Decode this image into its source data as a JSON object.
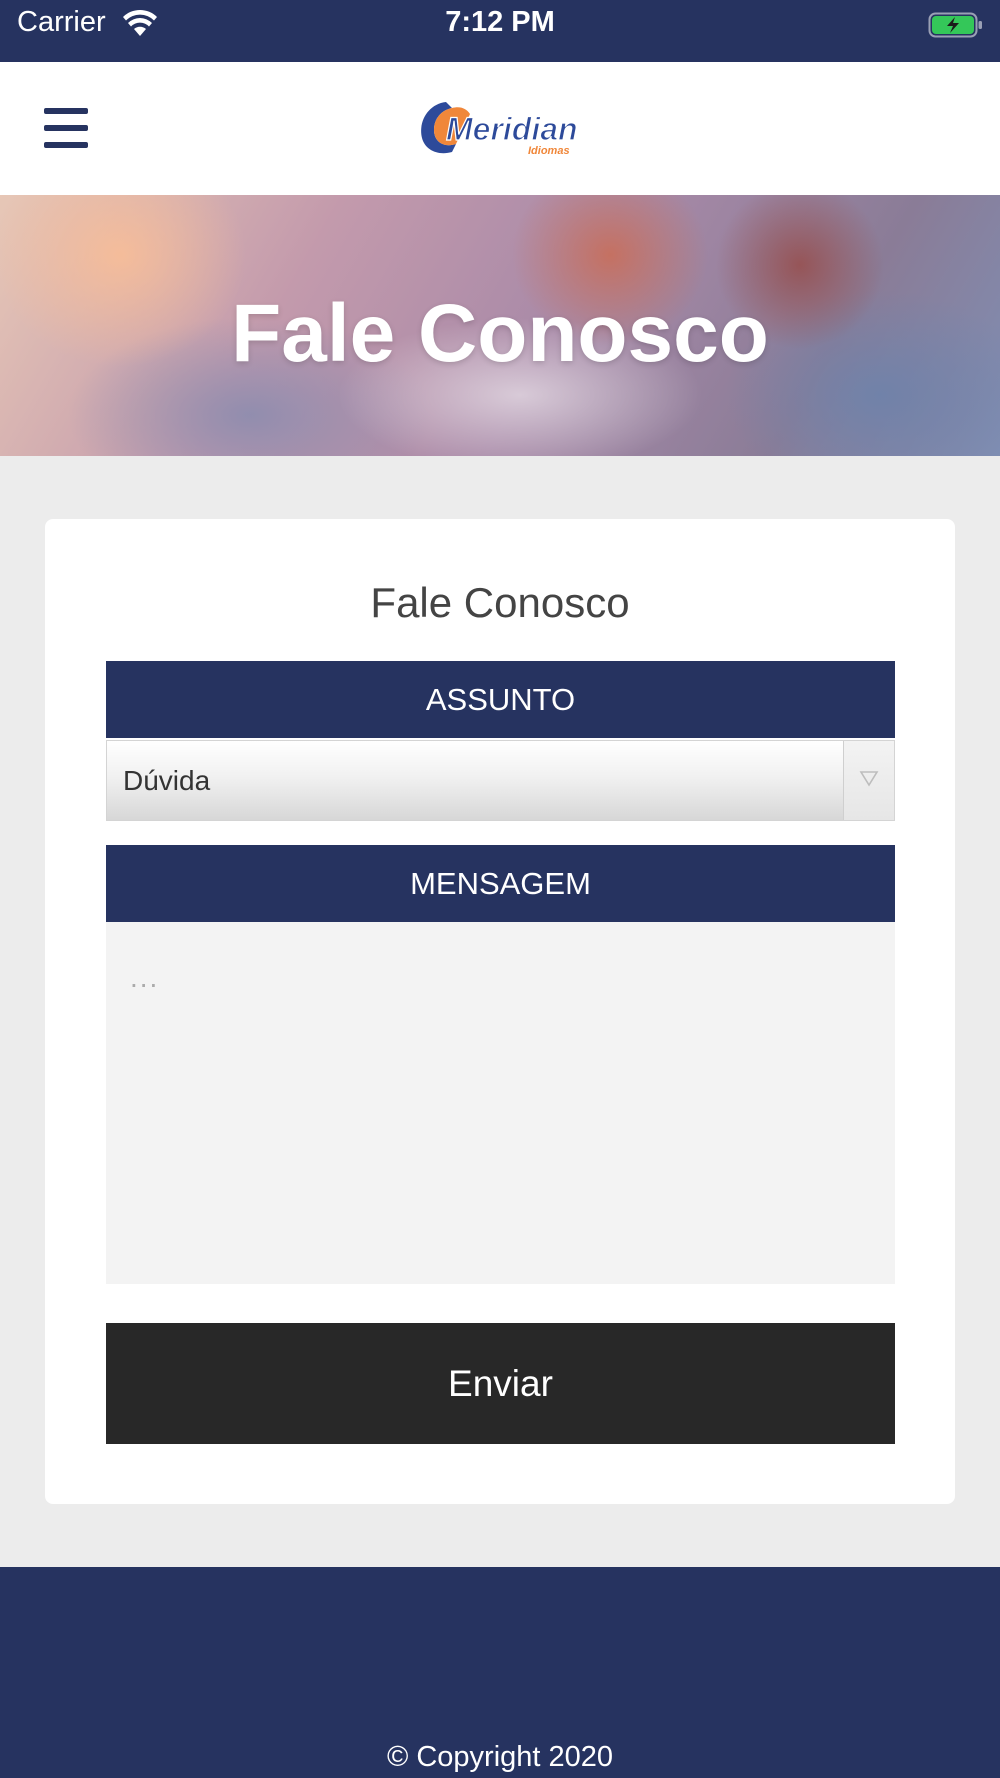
{
  "status_bar": {
    "carrier": "Carrier",
    "time": "7:12 PM",
    "battery_color": "#34c759"
  },
  "header": {
    "logo_text": "Meridian",
    "logo_subtext": "Idiomas",
    "brand_color": "#263360",
    "logo_accent": "#f0873a"
  },
  "hero": {
    "title": "Fale Conosco"
  },
  "form": {
    "title": "Fale Conosco",
    "subject_label": "ASSUNTO",
    "subject_value": "Dúvida",
    "message_label": "MENSAGEM",
    "message_placeholder": "...",
    "submit_label": "Enviar"
  },
  "footer": {
    "copyright": "© Copyright 2020"
  }
}
